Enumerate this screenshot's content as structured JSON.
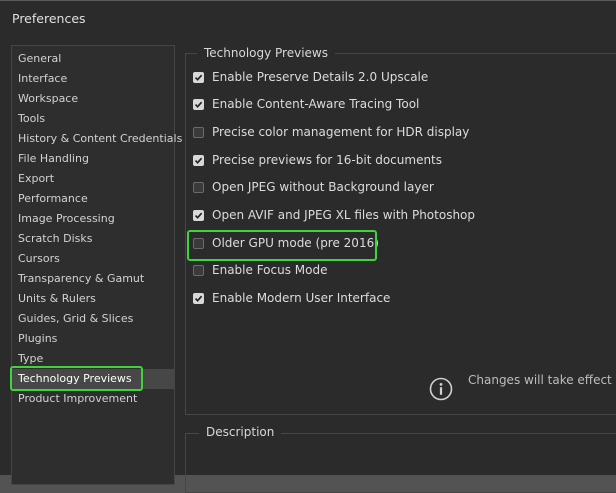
{
  "window": {
    "title": "Preferences"
  },
  "sidebar": {
    "items": [
      {
        "label": "General"
      },
      {
        "label": "Interface"
      },
      {
        "label": "Workspace"
      },
      {
        "label": "Tools"
      },
      {
        "label": "History & Content Credentials"
      },
      {
        "label": "File Handling"
      },
      {
        "label": "Export"
      },
      {
        "label": "Performance"
      },
      {
        "label": "Image Processing"
      },
      {
        "label": "Scratch Disks"
      },
      {
        "label": "Cursors"
      },
      {
        "label": "Transparency & Gamut"
      },
      {
        "label": "Units & Rulers"
      },
      {
        "label": "Guides, Grid & Slices"
      },
      {
        "label": "Plugins"
      },
      {
        "label": "Type"
      },
      {
        "label": "Technology Previews"
      },
      {
        "label": "Product Improvement"
      }
    ],
    "selected": "Technology Previews"
  },
  "technology_previews": {
    "group_title": "Technology Previews",
    "options": [
      {
        "label": "Enable Preserve Details 2.0 Upscale",
        "checked": true
      },
      {
        "label": "Enable Content-Aware Tracing Tool",
        "checked": true
      },
      {
        "label": "Precise color management for HDR display",
        "checked": false
      },
      {
        "label": "Precise previews for 16-bit documents",
        "checked": true
      },
      {
        "label": "Open JPEG without Background layer",
        "checked": false
      },
      {
        "label": "Open AVIF and JPEG XL files with Photoshop",
        "checked": true
      },
      {
        "label": "Older GPU mode (pre 2016)",
        "checked": false
      },
      {
        "label": "Enable Focus Mode",
        "checked": false
      },
      {
        "label": "Enable Modern User Interface",
        "checked": true
      }
    ],
    "info_text": "Changes will take effect the",
    "info_icon": "info-icon"
  },
  "description": {
    "group_title": "Description"
  },
  "colors": {
    "highlight": "#3fd43b",
    "background": "#2b2b2b"
  }
}
